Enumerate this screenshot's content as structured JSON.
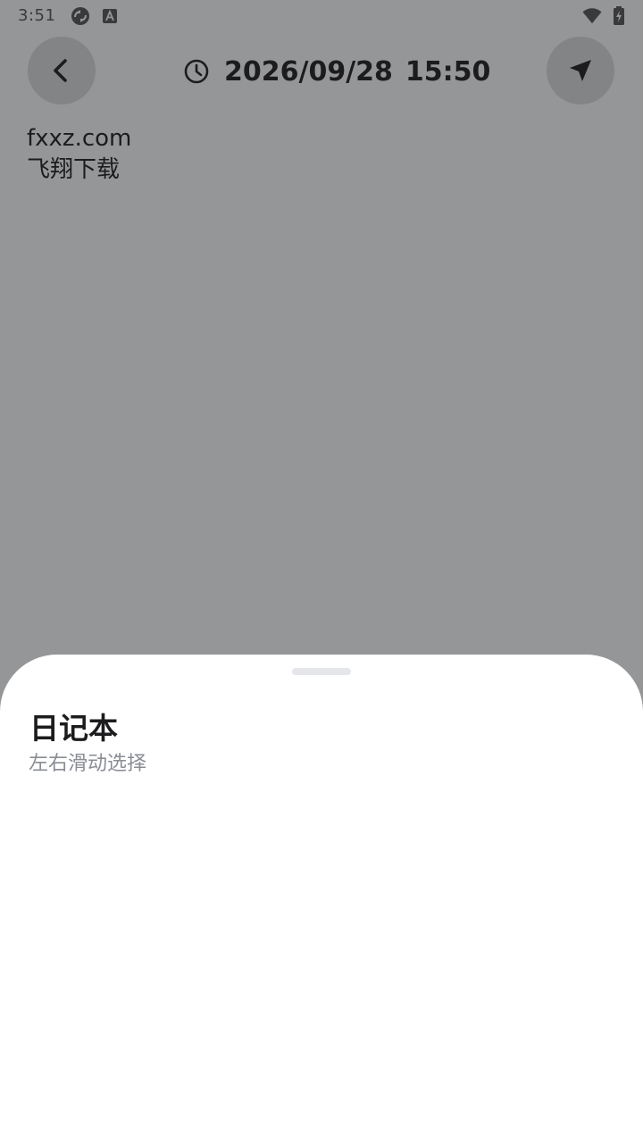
{
  "status_bar": {
    "time": "3:51",
    "icons": [
      "sync-icon",
      "font-app-icon",
      "wifi-icon",
      "battery-charging-icon"
    ]
  },
  "header": {
    "back_icon": "chevron-left-icon",
    "clock_icon": "clock-icon",
    "date": "2026/09/28",
    "time": "15:50",
    "send_icon": "send-icon"
  },
  "note": {
    "lines": [
      "fxxz.com",
      "飞翔下载"
    ]
  },
  "sheet": {
    "title": "日记本",
    "subtitle": "左右滑动选择"
  },
  "colors": {
    "scrim_background": "#959698",
    "button_background": "#838486",
    "sheet_background": "#ffffff",
    "primary_text": "#1c1c1e",
    "secondary_text": "#8a8d94",
    "handle": "#e4e6ea"
  }
}
